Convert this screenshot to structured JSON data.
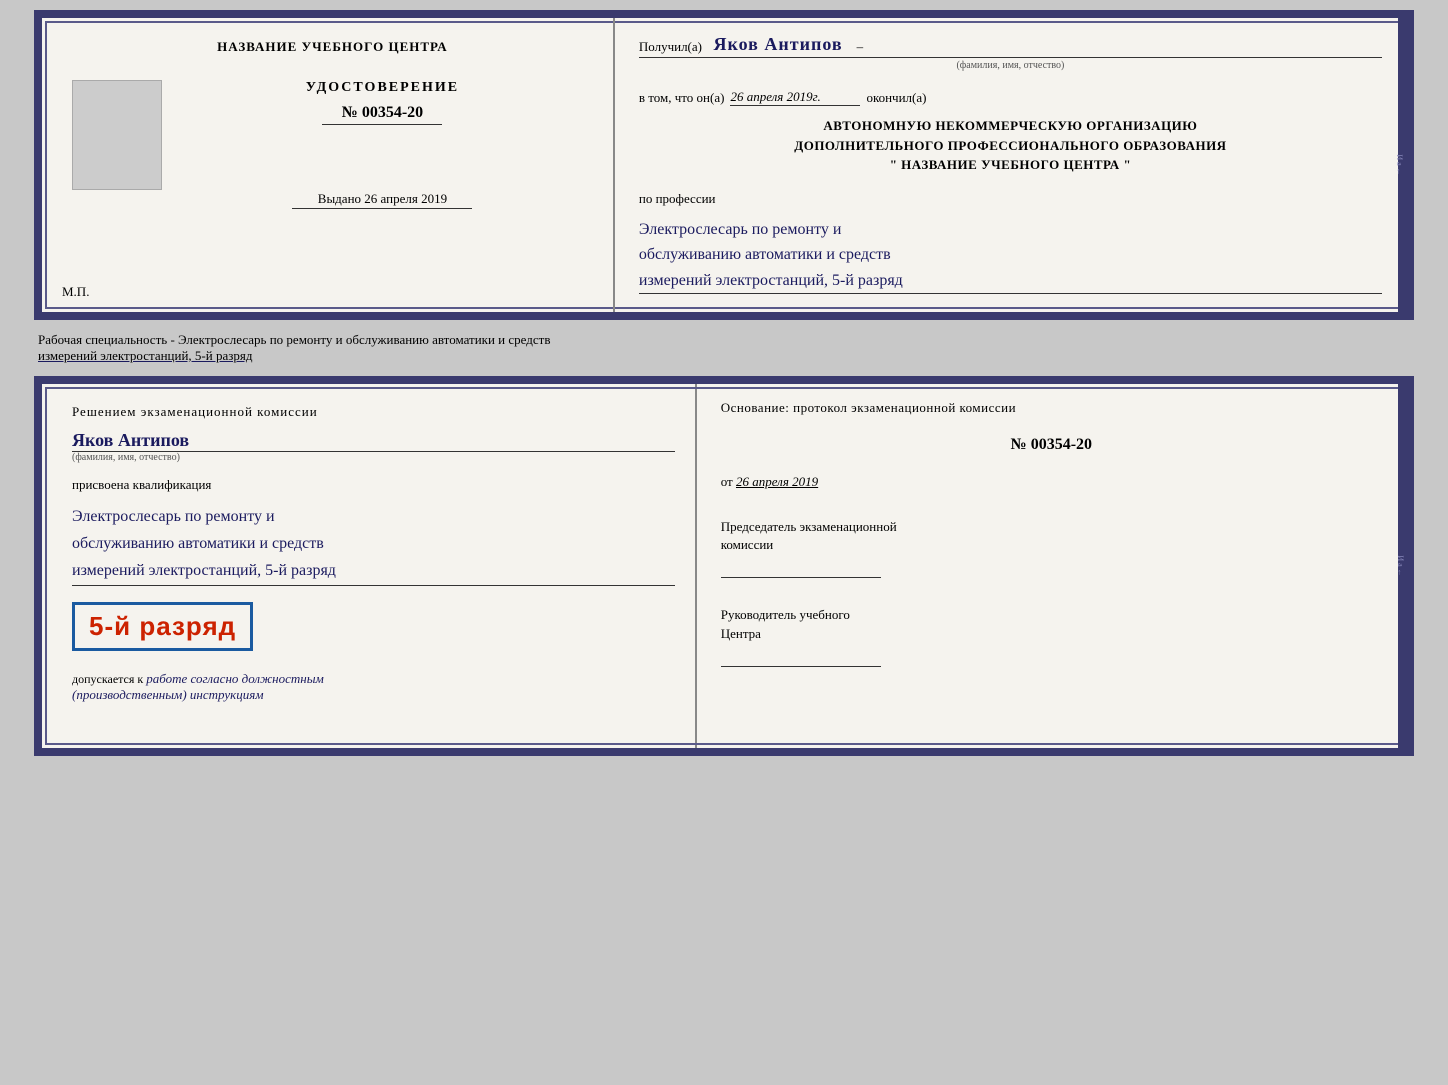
{
  "top_cert": {
    "left_panel": {
      "org_title": "НАЗВАНИЕ УЧЕБНОГО ЦЕНТРА",
      "cert_label": "УДОСТОВЕРЕНИЕ",
      "cert_number": "№ 00354-20",
      "issued_label": "Выдано",
      "issued_date": "26 апреля 2019",
      "mp_label": "М.П."
    },
    "right_panel": {
      "received_prefix": "Получил(а)",
      "recipient_name": "Яков Антипов",
      "recipient_subtext": "(фамилия, имя, отчество)",
      "in_that_prefix": "в том, что он(а)",
      "completion_date": "26 апреля 2019г.",
      "finished_word": "окончил(а)",
      "org_line1": "АВТОНОМНУЮ НЕКОММЕРЧЕСКУЮ ОРГАНИЗАЦИЮ",
      "org_line2": "ДОПОЛНИТЕЛЬНОГО ПРОФЕССИОНАЛЬНОГО ОБРАЗОВАНИЯ",
      "org_line3": "\"  НАЗВАНИЕ УЧЕБНОГО ЦЕНТРА  \"",
      "profession_label": "по профессии",
      "profession_line1": "Электрослесарь по ремонту и",
      "profession_line2": "обслуживанию автоматики и средств",
      "profession_line3": "измерений электростанций, 5-й разряд"
    }
  },
  "specialty_text": "Рабочая специальность - Электрослесарь по ремонту и обслуживанию автоматики и средств",
  "specialty_text2": "измерений электростанций, 5-й разряд",
  "bottom_cert": {
    "left_panel": {
      "decision_text": "Решением экзаменационной комиссии",
      "person_name": "Яков Антипов",
      "name_subtext": "(фамилия, имя, отчество)",
      "assigned_text": "присвоена квалификация",
      "qual_line1": "Электрослесарь по ремонту и",
      "qual_line2": "обслуживанию автоматики и средств",
      "qual_line3": "измерений электростанций, 5-й разряд",
      "rank_badge": "5-й разряд",
      "allowed_prefix": "допускается к",
      "allowed_text": "работе согласно должностным",
      "allowed_text2": "(производственным) инструкциям"
    },
    "right_panel": {
      "basis_text": "Основание: протокол экзаменационной комиссии",
      "protocol_number": "№  00354-20",
      "date_prefix": "от",
      "date_value": "26 апреля 2019",
      "chairman_title": "Председатель экзаменационной",
      "chairman_title2": "комиссии",
      "manager_title": "Руководитель учебного",
      "manager_title2": "Центра"
    }
  }
}
